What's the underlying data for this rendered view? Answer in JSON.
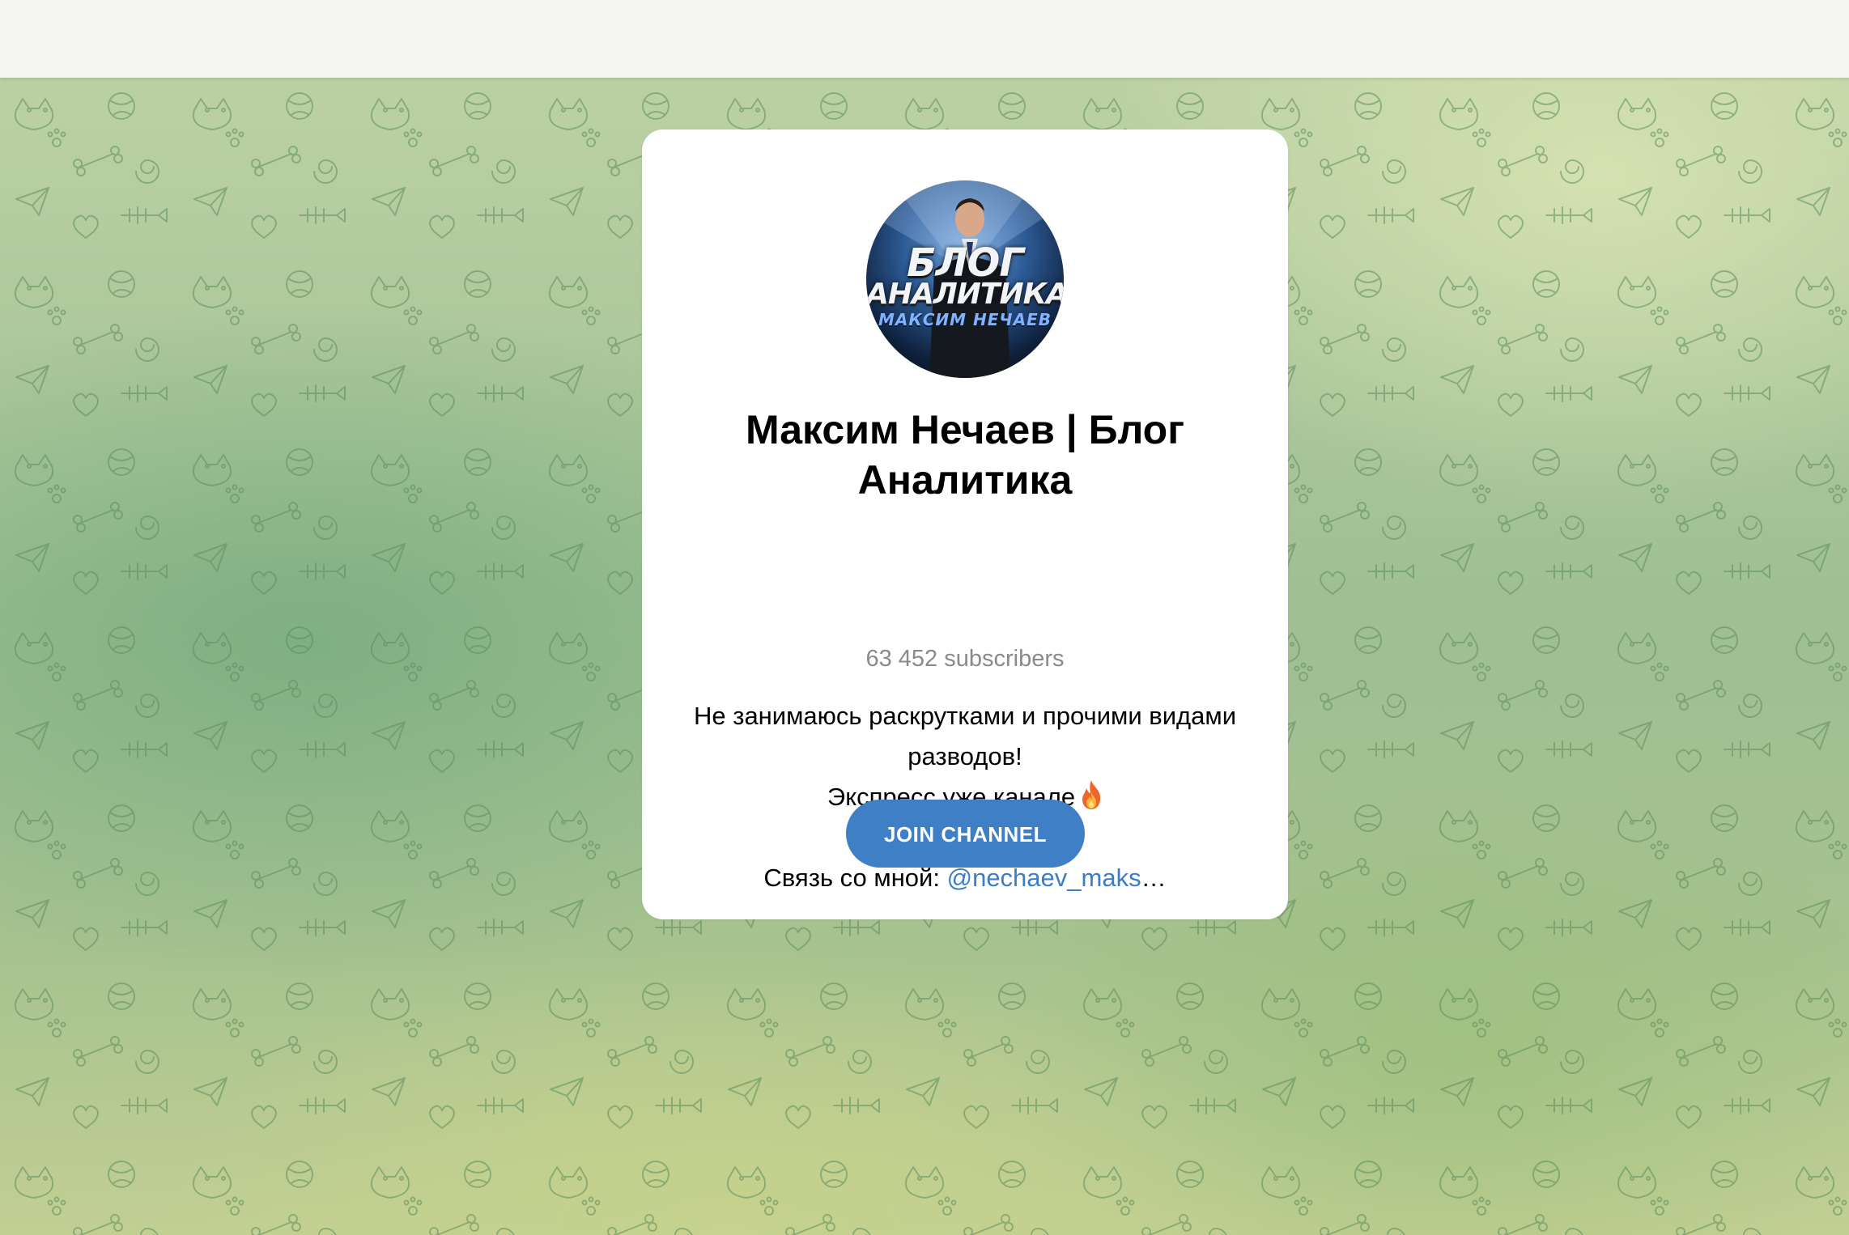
{
  "channel": {
    "title": "Максим Нечаев | Блог Аналитика",
    "subscribers": "63 452 subscribers",
    "description": {
      "line1": "Не занимаюсь раскрутками и прочими видами",
      "line2": "разводов!",
      "line3": "Экспресс уже канале",
      "contact_label": "Связь со мной:",
      "contact_link": "@nechaev_maks",
      "contact_ellipsis": "…"
    },
    "avatar": {
      "line1": "БЛОГ",
      "line2": "АНАЛИТИКА",
      "line3": "МАКСИМ НЕЧАЕВ"
    },
    "join_button": "JOIN CHANNEL"
  },
  "icons": {
    "fire": "fire-emoji-icon",
    "background": "doodle-pattern"
  },
  "colors": {
    "accent": "#3f7fc5",
    "link": "#3b7dc8",
    "subtitle": "#8a8a8e",
    "card": "#ffffff",
    "topbar": "#f5f6f2"
  }
}
